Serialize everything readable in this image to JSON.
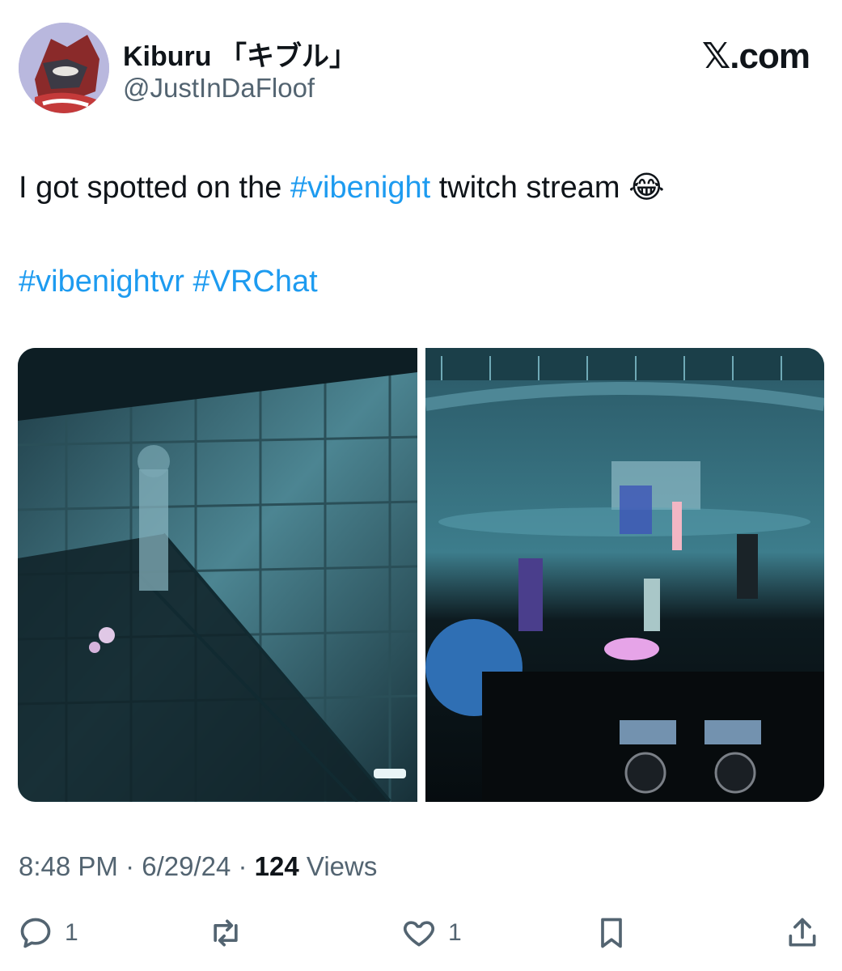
{
  "author": {
    "display_name": "Kiburu 「キブル」",
    "handle": "@JustInDaFloof"
  },
  "brand": "𝕏.com",
  "tweet": {
    "line1_prefix": "I got spotted on the ",
    "line1_tag": "#vibenight",
    "line1_suffix": " twitch stream ",
    "emoji": "😂",
    "tag2": "#vibenightvr",
    "tag3": "#VRChat"
  },
  "meta": {
    "time": "8:48 PM",
    "date": "6/29/24",
    "views_count": "124",
    "views_label": "Views"
  },
  "actions": {
    "reply_count": "1",
    "like_count": "1"
  },
  "icons": {
    "reply": "reply-icon",
    "repost": "repost-icon",
    "like": "heart-icon",
    "bookmark": "bookmark-icon",
    "share": "share-icon"
  }
}
